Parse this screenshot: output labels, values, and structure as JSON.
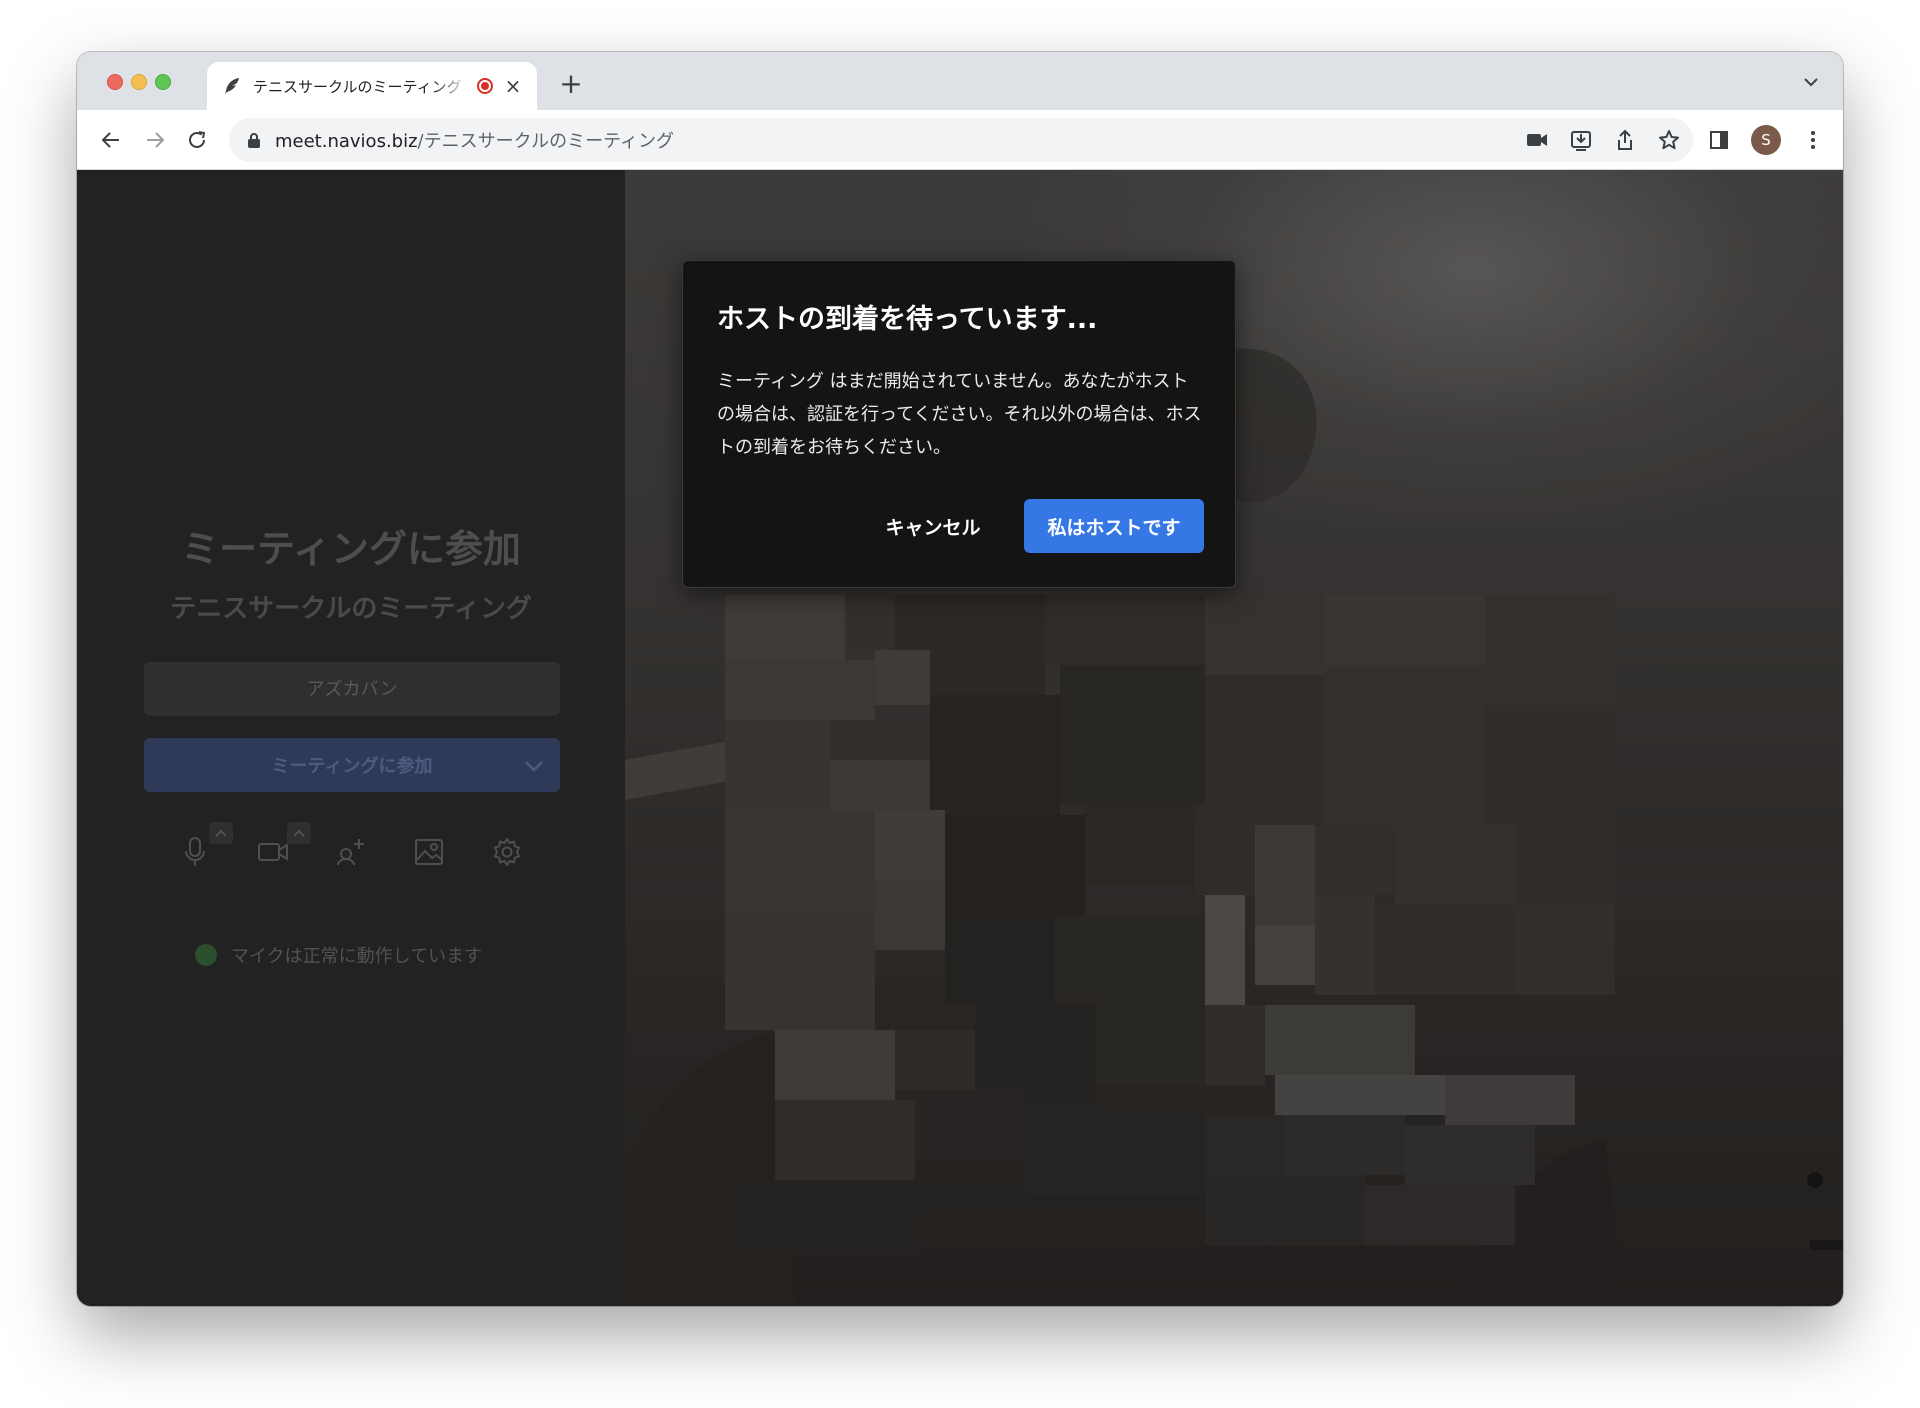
{
  "browser": {
    "tab": {
      "title": "テニスサークルのミーティング",
      "close_glyph": "×"
    },
    "new_tab_glyph": "+",
    "address": {
      "domain": "meet.navios.biz",
      "path": "/テニスサークルのミーティング"
    },
    "profile_initial": "S"
  },
  "join_panel": {
    "title": "ミーティングに参加",
    "meeting_name": "テニスサークルのミーティング",
    "name_input_placeholder": "アズカバン",
    "join_button_label": "ミーティングに参加",
    "mic_status": "マイクは正常に動作しています",
    "controls": [
      "microphone-icon",
      "camera-icon",
      "invite-icon",
      "background-icon",
      "settings-icon"
    ]
  },
  "dialog": {
    "title": "ホストの到着を待っています...",
    "body": "ミーティング はまだ開始されていません。あなたがホストの場合は、認証を行ってください。それ以外の場合は、ホストの到着をお待ちください。",
    "cancel_label": "キャンセル",
    "host_label": "私はホストです"
  },
  "colors": {
    "accent": "#3578e5",
    "panel_bg": "#222223",
    "dialog_bg": "#141414",
    "mic_ok": "#2c4f30"
  }
}
